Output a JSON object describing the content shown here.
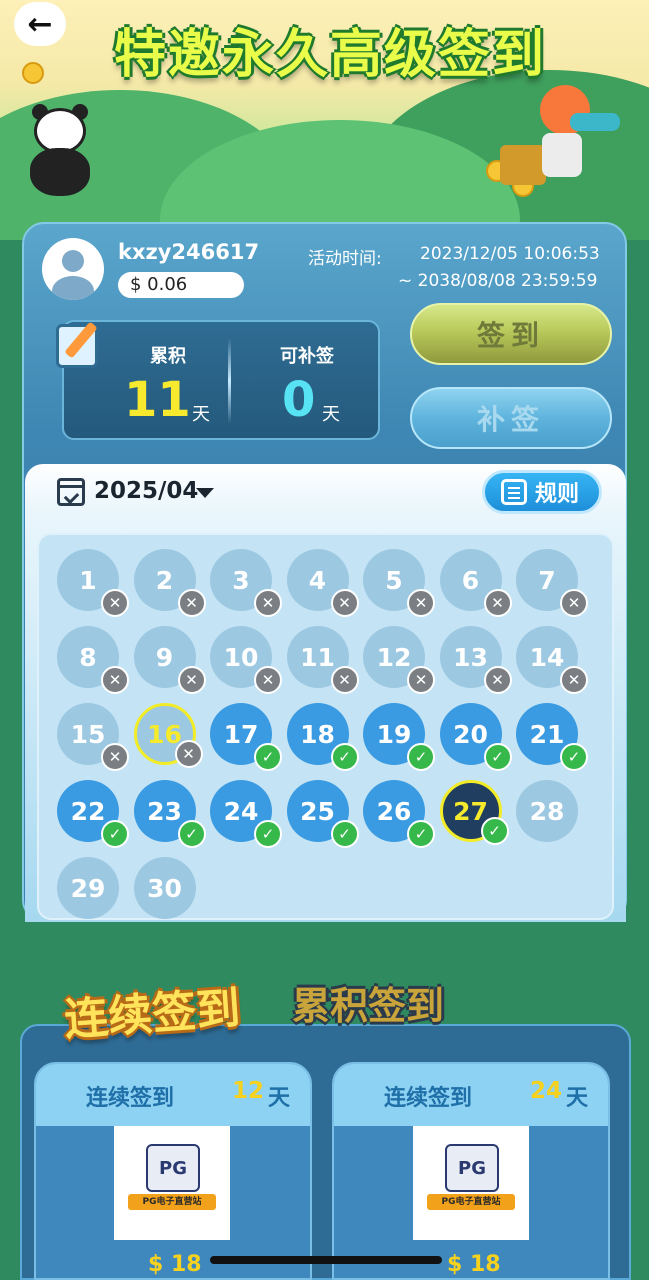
{
  "header": {
    "back_icon": "arrow-left-icon",
    "title": "特邀永久高级签到"
  },
  "user": {
    "name": "kxzy246617",
    "balance": "$ 0.06",
    "avatar_icon": "user-avatar-icon"
  },
  "activity": {
    "label": "活动时间:",
    "start": "2023/12/05 10:06:53",
    "end": "~ 2038/08/08 23:59:59"
  },
  "stats": {
    "accumulated_label": "累积",
    "accumulated_value": "11",
    "accumulated_unit": "天",
    "makeup_label": "可补签",
    "makeup_value": "0",
    "makeup_unit": "天",
    "accumulated_color": "#f6e92e",
    "makeup_color": "#58e3f5"
  },
  "actions": {
    "sign_label": "签到",
    "makeup_label": "补签"
  },
  "calendar": {
    "month": "2025/04",
    "rules_label": "规则",
    "days": [
      {
        "n": "1",
        "state": "missed"
      },
      {
        "n": "2",
        "state": "missed"
      },
      {
        "n": "3",
        "state": "missed"
      },
      {
        "n": "4",
        "state": "missed"
      },
      {
        "n": "5",
        "state": "missed"
      },
      {
        "n": "6",
        "state": "missed"
      },
      {
        "n": "7",
        "state": "missed"
      },
      {
        "n": "8",
        "state": "missed"
      },
      {
        "n": "9",
        "state": "missed"
      },
      {
        "n": "10",
        "state": "missed"
      },
      {
        "n": "11",
        "state": "missed"
      },
      {
        "n": "12",
        "state": "missed"
      },
      {
        "n": "13",
        "state": "missed"
      },
      {
        "n": "14",
        "state": "missed"
      },
      {
        "n": "15",
        "state": "missed"
      },
      {
        "n": "16",
        "state": "makeup"
      },
      {
        "n": "17",
        "state": "done"
      },
      {
        "n": "18",
        "state": "done"
      },
      {
        "n": "19",
        "state": "done"
      },
      {
        "n": "20",
        "state": "done"
      },
      {
        "n": "21",
        "state": "done"
      },
      {
        "n": "22",
        "state": "done"
      },
      {
        "n": "23",
        "state": "done"
      },
      {
        "n": "24",
        "state": "done"
      },
      {
        "n": "25",
        "state": "done"
      },
      {
        "n": "26",
        "state": "done"
      },
      {
        "n": "27",
        "state": "today"
      },
      {
        "n": "28",
        "state": "future"
      },
      {
        "n": "29",
        "state": "future"
      },
      {
        "n": "30",
        "state": "future"
      }
    ]
  },
  "rewards": {
    "tab_consecutive": "连续签到",
    "tab_accumulated": "累积签到",
    "cards": [
      {
        "title": "连续签到",
        "days": "12",
        "unit": "天",
        "amount": "$ 18",
        "logo_text": "PG",
        "ribbon_text": "PG电子直营站"
      },
      {
        "title": "连续签到",
        "days": "24",
        "unit": "天",
        "amount": "$ 18",
        "logo_text": "PG",
        "ribbon_text": "PG电子直营站"
      }
    ]
  }
}
